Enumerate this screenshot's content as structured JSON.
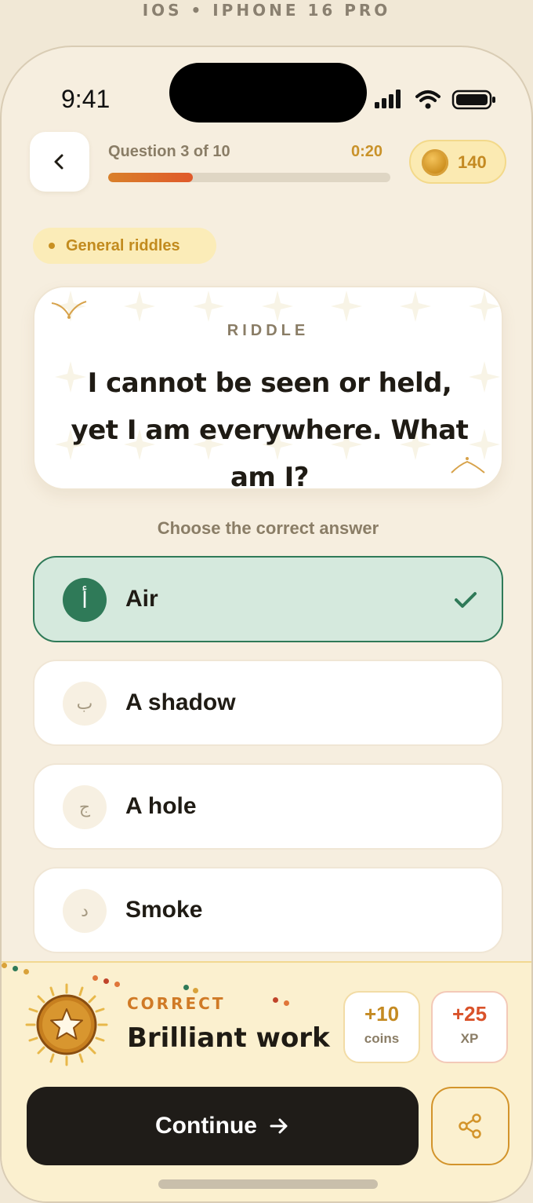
{
  "device_caption": "IOS • IPHONE 16 PRO",
  "status_bar": {
    "time": "9:41"
  },
  "header": {
    "progress_label": "Question 3 of 10",
    "timer": "0:20",
    "progress_fraction": 0.3,
    "coins": "140"
  },
  "category": "General riddles",
  "riddle": {
    "kicker": "RIDDLE",
    "question": "I cannot be seen or held, yet I am everywhere. What am I?"
  },
  "choose_label": "Choose the correct answer",
  "options": [
    {
      "badge": "أ",
      "label": "Air",
      "state": "correct"
    },
    {
      "badge": "ب",
      "label": "A shadow",
      "state": "default"
    },
    {
      "badge": "ج",
      "label": "A hole",
      "state": "default"
    },
    {
      "badge": "د",
      "label": "Smoke",
      "state": "default"
    }
  ],
  "result": {
    "kicker": "CORRECT",
    "title": "Brilliant work",
    "coins_value": "+10",
    "coins_unit": "coins",
    "xp_value": "+25",
    "xp_unit": "XP"
  },
  "continue_label": "Continue",
  "colors": {
    "accent_gold": "#c48a22",
    "correct_green": "#2f7a58",
    "xp_orange": "#d9522a",
    "dark_button": "#1f1c18"
  },
  "icons": {
    "back": "chevron-left-icon",
    "check": "check-icon",
    "continue": "arrow-right-icon",
    "share": "share-icon",
    "medal": "star-medal-icon",
    "coin": "coin-icon"
  }
}
